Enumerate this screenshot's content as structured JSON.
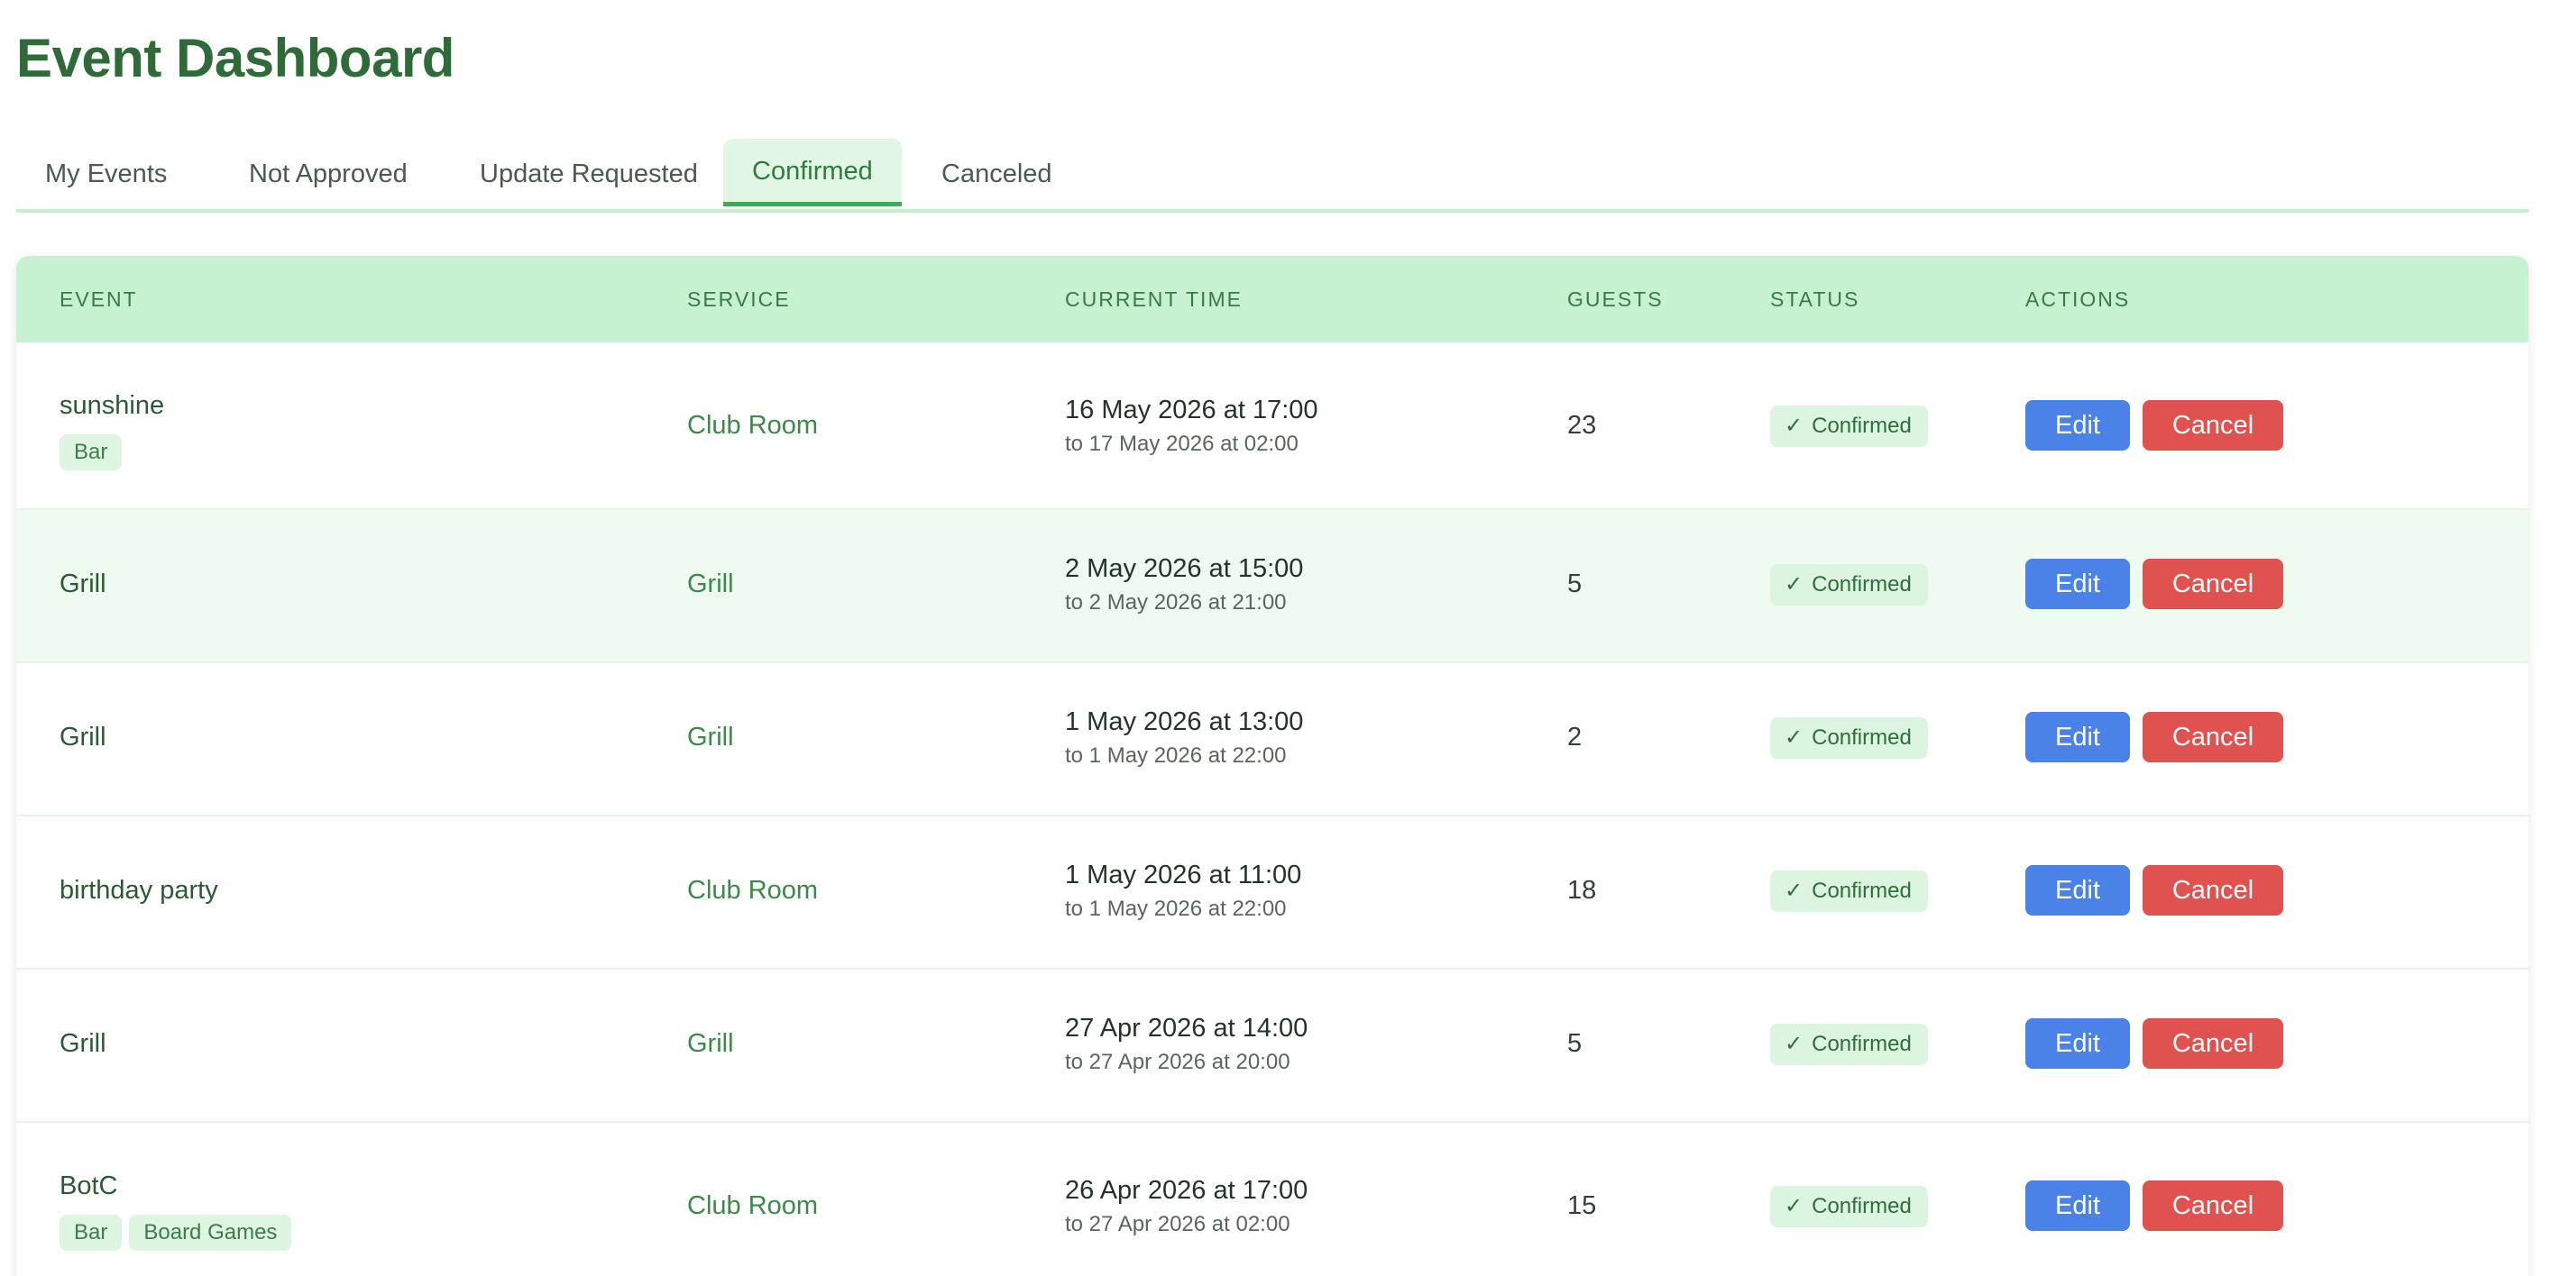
{
  "header": {
    "title": "Event Dashboard"
  },
  "tabs": [
    {
      "label": "My Events",
      "active": false
    },
    {
      "label": "Not Approved",
      "active": false
    },
    {
      "label": "Update Requested",
      "active": false
    },
    {
      "label": "Confirmed",
      "active": true
    },
    {
      "label": "Canceled",
      "active": false
    }
  ],
  "table": {
    "columns": [
      "EVENT",
      "SERVICE",
      "CURRENT TIME",
      "GUESTS",
      "STATUS",
      "ACTIONS"
    ],
    "rows": [
      {
        "event": "sunshine",
        "tags": [
          "Bar"
        ],
        "service": "Club Room",
        "time_main": "16 May 2026 at 17:00",
        "time_sub": "to 17 May 2026 at 02:00",
        "guests": "23",
        "status": "Confirmed",
        "edit_label": "Edit",
        "cancel_label": "Cancel"
      },
      {
        "event": "Grill",
        "tags": [],
        "service": "Grill",
        "time_main": "2 May 2026 at 15:00",
        "time_sub": "to 2 May 2026 at 21:00",
        "guests": "5",
        "status": "Confirmed",
        "edit_label": "Edit",
        "cancel_label": "Cancel"
      },
      {
        "event": "Grill",
        "tags": [],
        "service": "Grill",
        "time_main": "1 May 2026 at 13:00",
        "time_sub": "to 1 May 2026 at 22:00",
        "guests": "2",
        "status": "Confirmed",
        "edit_label": "Edit",
        "cancel_label": "Cancel"
      },
      {
        "event": "birthday party",
        "tags": [],
        "service": "Club Room",
        "time_main": "1 May 2026 at 11:00",
        "time_sub": "to 1 May 2026 at 22:00",
        "guests": "18",
        "status": "Confirmed",
        "edit_label": "Edit",
        "cancel_label": "Cancel"
      },
      {
        "event": "Grill",
        "tags": [],
        "service": "Grill",
        "time_main": "27 Apr 2026 at 14:00",
        "time_sub": "to 27 Apr 2026 at 20:00",
        "guests": "5",
        "status": "Confirmed",
        "edit_label": "Edit",
        "cancel_label": "Cancel"
      },
      {
        "event": "BotC",
        "tags": [
          "Bar",
          "Board Games"
        ],
        "service": "Club Room",
        "time_main": "26 Apr 2026 at 17:00",
        "time_sub": "to 27 Apr 2026 at 02:00",
        "guests": "15",
        "status": "Confirmed",
        "edit_label": "Edit",
        "cancel_label": "Cancel"
      }
    ]
  },
  "icons": {
    "status_check": "check-icon"
  },
  "colors": {
    "brand_green": "#2e6b38",
    "header_bg": "#c7f2d1",
    "edit_blue": "#4a82e8",
    "cancel_red": "#e0524f"
  }
}
